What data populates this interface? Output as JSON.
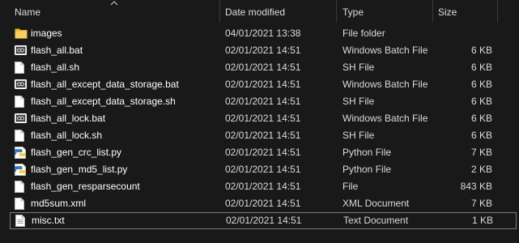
{
  "columns": {
    "name": "Name",
    "date": "Date modified",
    "type": "Type",
    "size": "Size"
  },
  "files": [
    {
      "name": "images",
      "date": "04/01/2021 13:38",
      "type": "File folder",
      "size": "",
      "icon": "folder-icon"
    },
    {
      "name": "flash_all.bat",
      "date": "02/01/2021 14:51",
      "type": "Windows Batch File",
      "size": "6 KB",
      "icon": "batch-file-icon"
    },
    {
      "name": "flash_all.sh",
      "date": "02/01/2021 14:51",
      "type": "SH File",
      "size": "6 KB",
      "icon": "file-icon"
    },
    {
      "name": "flash_all_except_data_storage.bat",
      "date": "02/01/2021 14:51",
      "type": "Windows Batch File",
      "size": "6 KB",
      "icon": "batch-file-icon"
    },
    {
      "name": "flash_all_except_data_storage.sh",
      "date": "02/01/2021 14:51",
      "type": "SH File",
      "size": "6 KB",
      "icon": "file-icon"
    },
    {
      "name": "flash_all_lock.bat",
      "date": "02/01/2021 14:51",
      "type": "Windows Batch File",
      "size": "6 KB",
      "icon": "batch-file-icon"
    },
    {
      "name": "flash_all_lock.sh",
      "date": "02/01/2021 14:51",
      "type": "SH File",
      "size": "6 KB",
      "icon": "file-icon"
    },
    {
      "name": "flash_gen_crc_list.py",
      "date": "02/01/2021 14:51",
      "type": "Python File",
      "size": "7 KB",
      "icon": "python-file-icon"
    },
    {
      "name": "flash_gen_md5_list.py",
      "date": "02/01/2021 14:51",
      "type": "Python File",
      "size": "2 KB",
      "icon": "python-file-icon"
    },
    {
      "name": "flash_gen_resparsecount",
      "date": "02/01/2021 14:51",
      "type": "File",
      "size": "843 KB",
      "icon": "file-icon"
    },
    {
      "name": "md5sum.xml",
      "date": "02/01/2021 14:51",
      "type": "XML Document",
      "size": "7 KB",
      "icon": "file-icon"
    },
    {
      "name": "misc.txt",
      "date": "02/01/2021 14:51",
      "type": "Text Document",
      "size": "1 KB",
      "icon": "text-file-icon"
    }
  ],
  "selected_index": 11,
  "colors": {
    "background": "#191919",
    "folder": "#f2c14e",
    "python_blue": "#3d7ab8",
    "python_yellow": "#f5d04a",
    "selection_border": "#7a7a7a"
  }
}
